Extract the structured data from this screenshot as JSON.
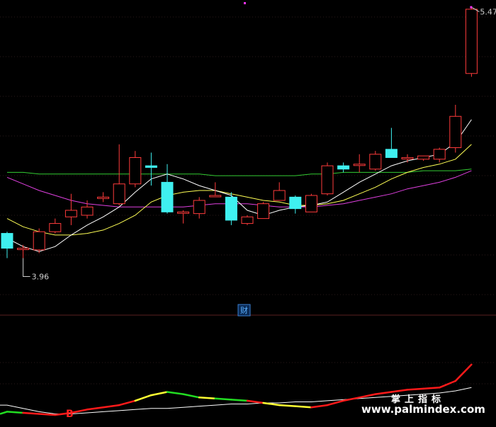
{
  "chart_data": {
    "type": "candlestick",
    "price_labels": {
      "high": "5.47",
      "low": "3.96"
    },
    "badge": "财",
    "signal": "B",
    "watermark": {
      "cn": "掌上指标",
      "url": "www.palmindex.com"
    },
    "colors": {
      "up": "#ff3b3b",
      "down": "#3ff0f0",
      "ma_fast": "#ffffff",
      "ma_mid": "#ffff55",
      "ma_slow": "#e040e0",
      "ma_long": "#33cc33",
      "indicator_red": "#ff1a1a",
      "indicator_yellow": "#ffff33",
      "indicator_green": "#22dd22",
      "indicator_base": "#ffffff"
    },
    "price_range": [
      3.7,
      5.5
    ],
    "candles": [
      {
        "o": 4.11,
        "h": 4.12,
        "l": 3.96,
        "c": 4.02
      },
      {
        "o": 4.02,
        "h": 4.04,
        "l": 3.96,
        "c": 4.02
      },
      {
        "o": 4.01,
        "h": 4.14,
        "l": 3.99,
        "c": 4.12
      },
      {
        "o": 4.12,
        "h": 4.2,
        "l": 4.11,
        "c": 4.17
      },
      {
        "o": 4.21,
        "h": 4.35,
        "l": 4.16,
        "c": 4.25
      },
      {
        "o": 4.22,
        "h": 4.31,
        "l": 4.2,
        "c": 4.27
      },
      {
        "o": 4.33,
        "h": 4.36,
        "l": 4.3,
        "c": 4.33
      },
      {
        "o": 4.29,
        "h": 4.65,
        "l": 4.28,
        "c": 4.41
      },
      {
        "o": 4.41,
        "h": 4.61,
        "l": 4.39,
        "c": 4.57
      },
      {
        "o": 4.52,
        "h": 4.6,
        "l": 4.4,
        "c": 4.51
      },
      {
        "o": 4.42,
        "h": 4.53,
        "l": 4.23,
        "c": 4.24
      },
      {
        "o": 4.24,
        "h": 4.25,
        "l": 4.17,
        "c": 4.24
      },
      {
        "o": 4.23,
        "h": 4.33,
        "l": 4.2,
        "c": 4.31
      },
      {
        "o": 4.34,
        "h": 4.42,
        "l": 4.33,
        "c": 4.34
      },
      {
        "o": 4.33,
        "h": 4.36,
        "l": 4.16,
        "c": 4.19
      },
      {
        "o": 4.17,
        "h": 4.22,
        "l": 4.16,
        "c": 4.21
      },
      {
        "o": 4.2,
        "h": 4.3,
        "l": 4.2,
        "c": 4.29
      },
      {
        "o": 4.31,
        "h": 4.42,
        "l": 4.32,
        "c": 4.37
      },
      {
        "o": 4.33,
        "h": 4.34,
        "l": 4.23,
        "c": 4.26
      },
      {
        "o": 4.24,
        "h": 4.35,
        "l": 4.24,
        "c": 4.34
      },
      {
        "o": 4.35,
        "h": 4.54,
        "l": 4.34,
        "c": 4.52
      },
      {
        "o": 4.52,
        "h": 4.54,
        "l": 4.48,
        "c": 4.5
      },
      {
        "o": 4.53,
        "h": 4.59,
        "l": 4.48,
        "c": 4.53
      },
      {
        "o": 4.5,
        "h": 4.61,
        "l": 4.49,
        "c": 4.59
      },
      {
        "o": 4.62,
        "h": 4.75,
        "l": 4.57,
        "c": 4.57
      },
      {
        "o": 4.57,
        "h": 4.59,
        "l": 4.54,
        "c": 4.57
      },
      {
        "o": 4.56,
        "h": 4.58,
        "l": 4.55,
        "c": 4.58
      },
      {
        "o": 4.56,
        "h": 4.63,
        "l": 4.54,
        "c": 4.62
      },
      {
        "o": 4.63,
        "h": 4.89,
        "l": 4.6,
        "c": 4.82
      },
      {
        "o": 5.08,
        "h": 5.48,
        "l": 5.06,
        "c": 5.47
      }
    ],
    "ma_fast": [
      4.08,
      4.03,
      4.0,
      4.03,
      4.1,
      4.16,
      4.21,
      4.27,
      4.36,
      4.44,
      4.47,
      4.44,
      4.4,
      4.37,
      4.34,
      4.25,
      4.22,
      4.25,
      4.27,
      4.28,
      4.3,
      4.36,
      4.42,
      4.47,
      4.52,
      4.55,
      4.57,
      4.59,
      4.66,
      4.8
    ],
    "ma_mid": [
      4.2,
      4.15,
      4.12,
      4.1,
      4.1,
      4.11,
      4.13,
      4.17,
      4.22,
      4.3,
      4.34,
      4.36,
      4.37,
      4.37,
      4.35,
      4.33,
      4.31,
      4.3,
      4.28,
      4.28,
      4.29,
      4.31,
      4.35,
      4.39,
      4.44,
      4.48,
      4.51,
      4.53,
      4.56,
      4.65
    ],
    "ma_slow": [
      4.45,
      4.41,
      4.37,
      4.34,
      4.31,
      4.29,
      4.28,
      4.27,
      4.27,
      4.27,
      4.27,
      4.27,
      4.28,
      4.29,
      4.29,
      4.29,
      4.28,
      4.27,
      4.27,
      4.27,
      4.28,
      4.29,
      4.31,
      4.33,
      4.35,
      4.38,
      4.4,
      4.42,
      4.45,
      4.49
    ],
    "ma_long": [
      4.48,
      4.48,
      4.47,
      4.47,
      4.47,
      4.47,
      4.47,
      4.47,
      4.47,
      4.47,
      4.47,
      4.47,
      4.47,
      4.46,
      4.46,
      4.46,
      4.46,
      4.46,
      4.46,
      4.47,
      4.47,
      4.48,
      4.48,
      4.48,
      4.48,
      4.48,
      4.49,
      4.49,
      4.49,
      4.5
    ],
    "indicator_range": [
      0,
      100
    ],
    "indicator_main": [
      12,
      11,
      10,
      9,
      11,
      14,
      16,
      18,
      22,
      27,
      30,
      28,
      25,
      24,
      23,
      22,
      20,
      18,
      17,
      16,
      18,
      22,
      25,
      28,
      30,
      32,
      33,
      34,
      40,
      55
    ],
    "indicator_colors": [
      "green",
      "green",
      "red",
      "red",
      "red",
      "red",
      "red",
      "red",
      "red",
      "yellow",
      "yellow",
      "green",
      "green",
      "yellow",
      "green",
      "green",
      "red",
      "yellow",
      "yellow",
      "yellow",
      "red",
      "red",
      "red",
      "red",
      "red",
      "red",
      "red",
      "red",
      "red",
      "red"
    ],
    "indicator_base": [
      18,
      15,
      12,
      10,
      10,
      11,
      12,
      13,
      14,
      15,
      15,
      16,
      17,
      18,
      19,
      19,
      20,
      20,
      21,
      21,
      22,
      23,
      24,
      25,
      26,
      27,
      28,
      29,
      31,
      34
    ]
  }
}
